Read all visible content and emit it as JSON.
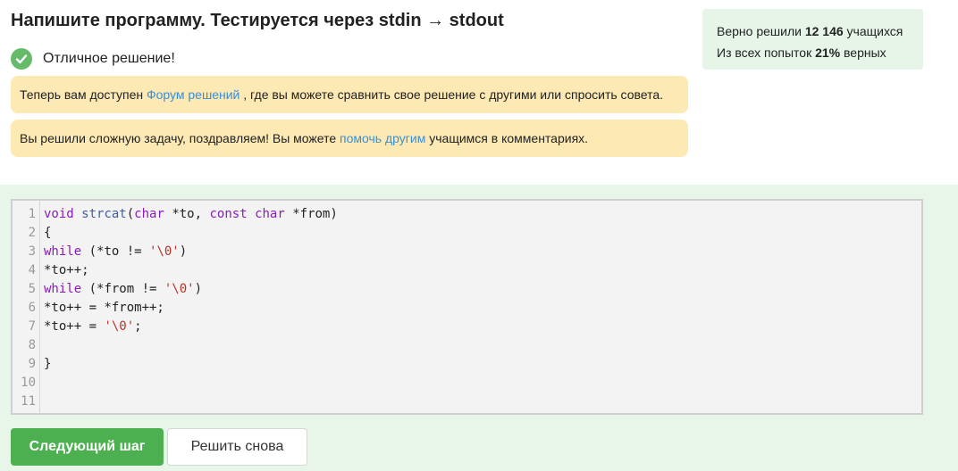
{
  "title": "Напишите программу. Тестируется через stdin → stdout",
  "result": {
    "icon": "check-circle-icon",
    "label": "Отличное решение!"
  },
  "notice_forum": {
    "prefix": "Теперь вам доступен ",
    "link": "Форум решений",
    "suffix": " , где вы можете сравнить свое решение с другими или спросить совета."
  },
  "notice_help": {
    "prefix": "Вы решили сложную задачу, поздравляем! Вы можете ",
    "link": "помочь другим",
    "suffix": " учащимся в комментариях."
  },
  "stats": {
    "solved_prefix": "Верно решили ",
    "solved_count": "12 146",
    "solved_suffix": " учащихся",
    "attempts_prefix": "Из всех попыток ",
    "attempts_percent": "21%",
    "attempts_suffix": " верных"
  },
  "editor": {
    "line_numbers": [
      "1",
      "2",
      "3",
      "4",
      "5",
      "6",
      "7",
      "8",
      "9",
      "10",
      "11"
    ],
    "lines": [
      "void strcat(char *to, const char *from)",
      "{",
      "while (*to != '\\0')",
      "*to++;",
      "while (*from != '\\0')",
      "*to++ = *from++;",
      "*to++ = '\\0';",
      "",
      "}",
      "",
      ""
    ]
  },
  "buttons": {
    "next": "Следующий шаг",
    "retry": "Решить снова"
  },
  "colors": {
    "accent_green": "#4caf50",
    "link_blue": "#3a8fd9",
    "notice_bg": "#fde9b3",
    "stats_bg": "#e6f5e8"
  }
}
